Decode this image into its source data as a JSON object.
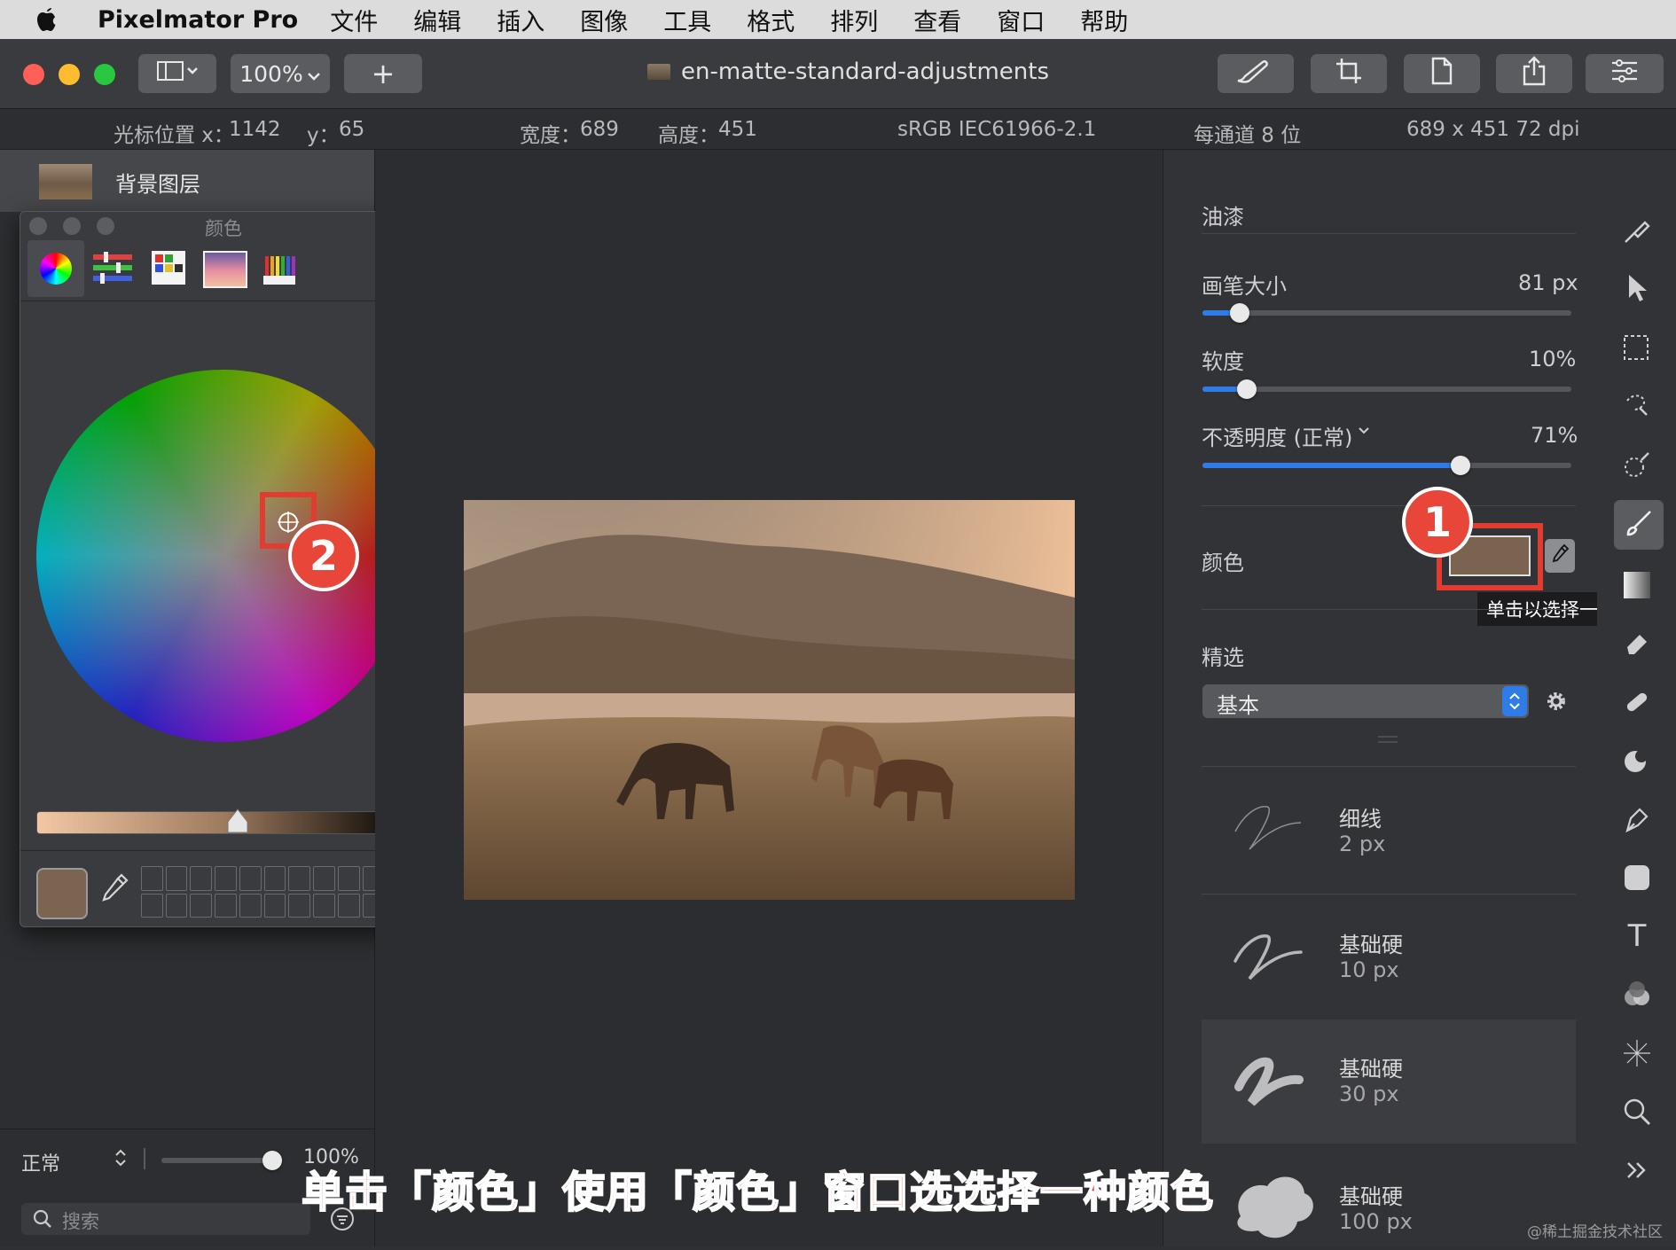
{
  "menubar": {
    "app_name": "Pixelmator Pro",
    "items": [
      "文件",
      "编辑",
      "插入",
      "图像",
      "工具",
      "格式",
      "排列",
      "查看",
      "窗口",
      "帮助"
    ]
  },
  "toolbar": {
    "zoom": "100%",
    "add_symbol": "+",
    "document_title": "en-matte-standard-adjustments"
  },
  "infobar": {
    "cursor_x_label": "光标位置 x：",
    "cursor_x": "1142",
    "cursor_y_label": "y：",
    "cursor_y": "65",
    "width_label": "宽度：",
    "width": "689",
    "height_label": "高度：",
    "height": "451",
    "color_profile": "sRGB IEC61966-2.1",
    "bit_depth": "每通道 8 位",
    "dimensions": "689 x 451 72 dpi"
  },
  "layers": {
    "layer_name": "背景图层",
    "blend_mode": "正常",
    "opacity": "100%",
    "search_placeholder": "搜索"
  },
  "color_window": {
    "title": "颜色",
    "current_color": "#7c6550"
  },
  "right_panel": {
    "section_title": "油漆",
    "brush_size_label": "画笔大小",
    "brush_size_value": "81 px",
    "brush_size_fraction": 0.1,
    "softness_label": "软度",
    "softness_value": "10%",
    "softness_fraction": 0.12,
    "opacity_label": "不透明度 (正常)",
    "opacity_value": "71%",
    "opacity_fraction": 0.7,
    "color_label": "颜色",
    "color_swatch": "#7a6450",
    "tooltip": "单击以选择一种颜色。",
    "presets_label": "精选",
    "preset_selected": "基本",
    "brushes": [
      {
        "name": "细线",
        "size": "2 px"
      },
      {
        "name": "基础硬",
        "size": "10 px"
      },
      {
        "name": "基础硬",
        "size": "30 px"
      },
      {
        "name": "基础硬",
        "size": "100 px"
      }
    ]
  },
  "annotations": {
    "badge_1": "1",
    "badge_2": "2",
    "caption": "单击「颜色」使用「颜色」窗口选选择一种颜色"
  },
  "watermark": "@稀土掘金技术社区",
  "colors": {
    "accent": "#2f7be8",
    "badge_red": "#e9463a"
  }
}
